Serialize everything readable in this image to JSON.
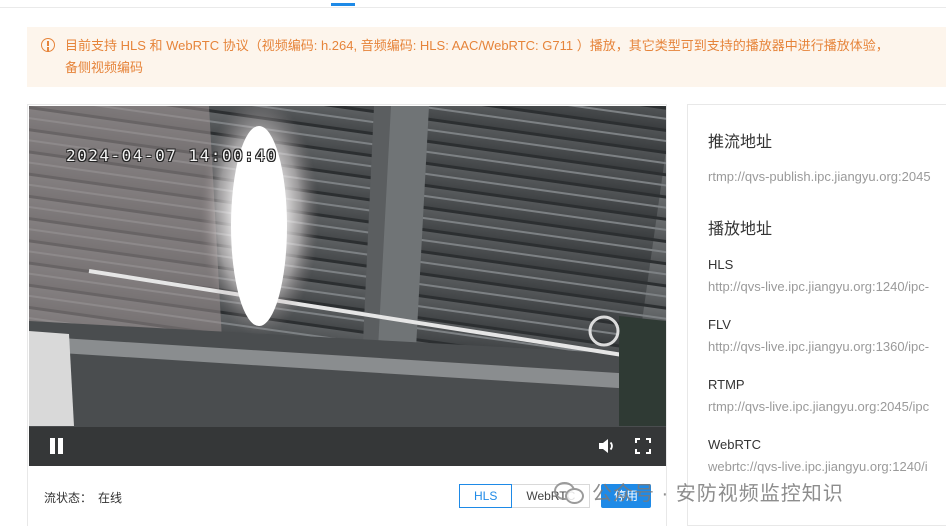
{
  "notice": {
    "line1": "目前支持 HLS 和 WebRTC 协议（视频编码: h.264, 音频编码: HLS: AAC/WebRTC: G711 ）播放，其它类型可到支持的播放器中进行播放体验，",
    "line2": "备侧视频编码",
    "icon": "info-circle-icon",
    "color": "#e6843a"
  },
  "video": {
    "osd_timestamp": "2024-04-07 14:00:40",
    "pause_icon": "pause-icon",
    "volume_icon": "volume-icon",
    "fullscreen_icon": "fullscreen-icon"
  },
  "stream": {
    "status_label": "流状态：",
    "status_value": "在线"
  },
  "protocols": {
    "options": [
      "HLS",
      "WebRTC"
    ],
    "selected": "HLS",
    "stop_label": "停用"
  },
  "addresses": {
    "publish_title": "推流地址",
    "publish_url": "rtmp://qvs-publish.ipc.jiangyu.org:2045",
    "play_title": "播放地址",
    "items": [
      {
        "name": "HLS",
        "url": "http://qvs-live.ipc.jiangyu.org:1240/ipc-"
      },
      {
        "name": "FLV",
        "url": "http://qvs-live.ipc.jiangyu.org:1360/ipc-"
      },
      {
        "name": "RTMP",
        "url": "rtmp://qvs-live.ipc.jiangyu.org:2045/ipc"
      },
      {
        "name": "WebRTC",
        "url": "webrtc://qvs-live.ipc.jiangyu.org:1240/i"
      }
    ]
  },
  "watermark": {
    "text": "公众号 · 安防视频监控知识",
    "icon": "wechat-icon"
  },
  "colors": {
    "accent": "#1e8ae7",
    "notice_bg": "#fdf5ec",
    "url_gray": "#9a9a9a"
  }
}
